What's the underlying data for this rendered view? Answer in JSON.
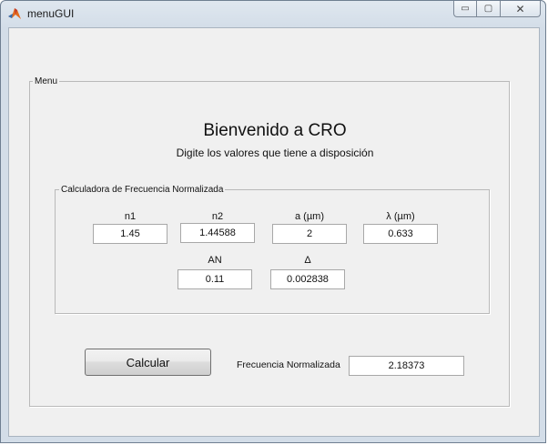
{
  "window": {
    "title": "menuGUI",
    "controls": {
      "minimize": "▭",
      "maximize": "▢",
      "close": "✕"
    }
  },
  "menu_panel": {
    "legend": "Menu",
    "title": "Bienvenido a  CRO",
    "subtitle": "Digite los valores que tiene a disposición"
  },
  "calculator": {
    "legend": "Calculadora de Frecuencia Normalizada",
    "fields": {
      "n1": {
        "label": "n1",
        "value": "1.45"
      },
      "n2": {
        "label": "n2",
        "value": "1.44588"
      },
      "a": {
        "label": "a (µm)",
        "value": "2"
      },
      "lambda": {
        "label": "λ (µm)",
        "value": "0.633"
      },
      "an": {
        "label": "AN",
        "value": "0.11"
      },
      "delta": {
        "label": "Δ",
        "value": "0.002838"
      }
    }
  },
  "action": {
    "calculate_label": "Calcular"
  },
  "result": {
    "label": "Frecuencia Normalizada",
    "value": "2.18373"
  },
  "colors": {
    "panel_bg": "#f0f0f0",
    "frame": "#d3dde8",
    "border": "#b9b9b9"
  }
}
